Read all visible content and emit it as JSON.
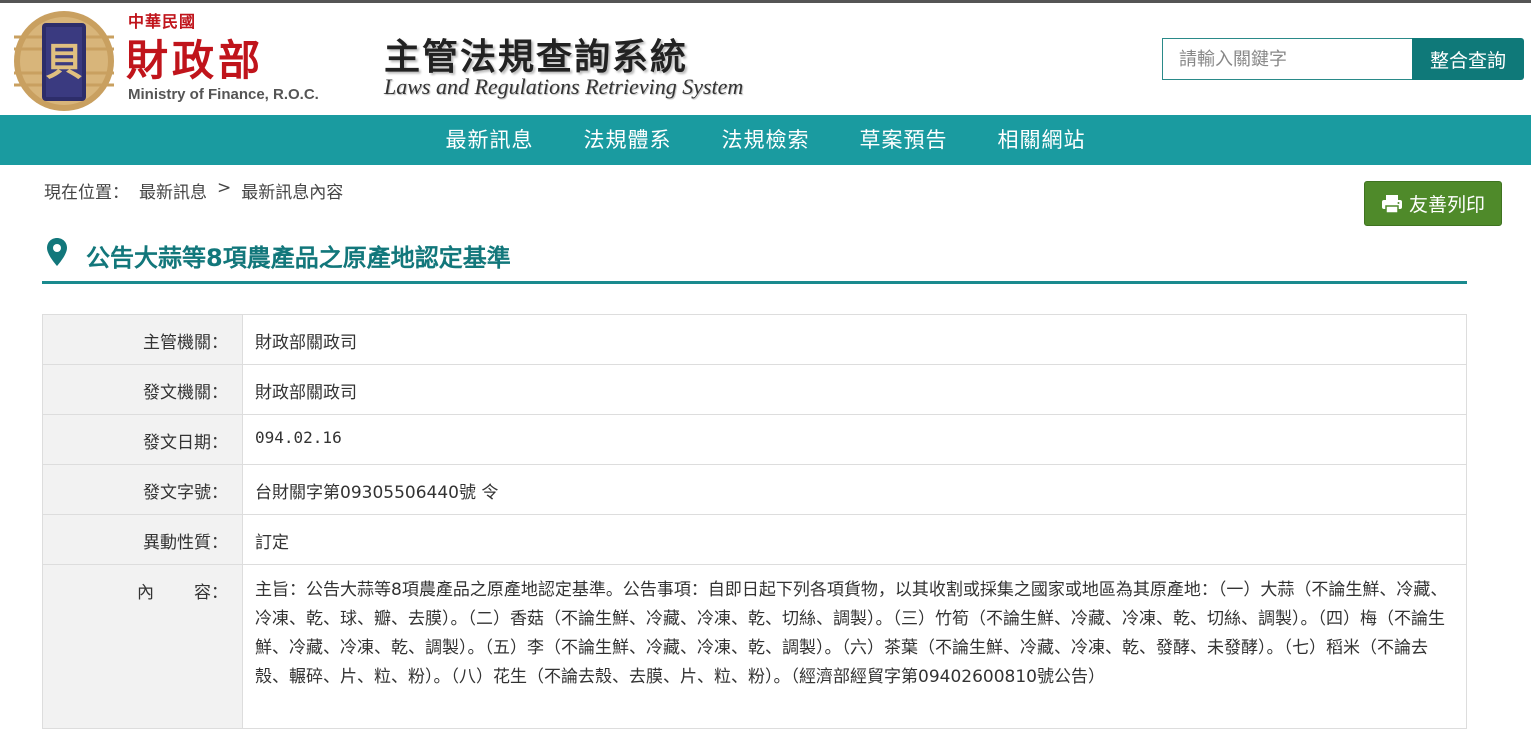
{
  "header": {
    "logo_country": "中華民國",
    "logo_ministry": "財政部",
    "logo_english": "Ministry of Finance, R.O.C.",
    "system_title_cn": "主管法規查詢系統",
    "system_title_en": "Laws and Regulations Retrieving System",
    "search_placeholder": "請輸入關鍵字",
    "search_button": "整合查詢"
  },
  "nav": {
    "items": [
      "最新訊息",
      "法規體系",
      "法規檢索",
      "草案預告",
      "相關網站"
    ]
  },
  "breadcrumb": {
    "prefix": "現在位置：",
    "items": [
      "最新訊息",
      "最新訊息內容"
    ],
    "separator": ">"
  },
  "print_button": "友善列印",
  "page_title": "公告大蒜等8項農產品之原產地認定基準",
  "fields": {
    "authority_label": "主管機關：",
    "authority_value": "財政部關政司",
    "issuer_label": "發文機關：",
    "issuer_value": "財政部關政司",
    "date_label": "發文日期：",
    "date_value": "094.02.16",
    "doc_no_label": "發文字號：",
    "doc_no_value": "台財關字第09305506440號 令",
    "change_type_label": "異動性質：",
    "change_type_value": "訂定",
    "content_label_1": "內",
    "content_label_2": "容：",
    "content_value": "主旨：公告大蒜等8項農產品之原產地認定基準。公告事項：自即日起下列各項貨物，以其收割或採集之國家或地區為其原產地：（一）大蒜（不論生鮮、冷藏、冷凍、乾、球、瓣、去膜）。（二）香菇（不論生鮮、冷藏、冷凍、乾、切絲、調製）。（三）竹筍（不論生鮮、冷藏、冷凍、乾、切絲、調製）。（四）梅（不論生鮮、冷藏、冷凍、乾、調製）。（五）李（不論生鮮、冷藏、冷凍、乾、調製）。（六）茶葉（不論生鮮、冷藏、冷凍、乾、發酵、未發酵）。（七）稻米（不論去殼、輾碎、片、粒、粉）。（八）花生（不論去殼、去膜、片、粒、粉）。（經濟部經貿字第09402600810號公告）"
  },
  "colors": {
    "nav_bg": "#1a9ba0",
    "search_button_bg": "#0f7979",
    "print_button_bg": "#4f8a2a",
    "title_color": "#12777b",
    "logo_red": "#c0141b"
  }
}
